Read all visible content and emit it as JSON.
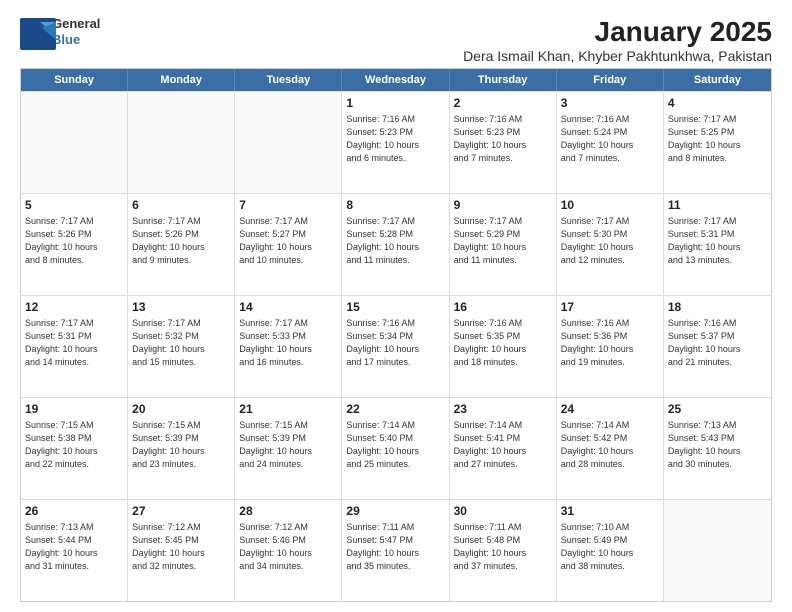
{
  "logo": {
    "line1": "General",
    "line2": "Blue"
  },
  "title": "January 2025",
  "subtitle": "Dera Ismail Khan, Khyber Pakhtunkhwa, Pakistan",
  "headers": [
    "Sunday",
    "Monday",
    "Tuesday",
    "Wednesday",
    "Thursday",
    "Friday",
    "Saturday"
  ],
  "weeks": [
    [
      {
        "day": "",
        "info": ""
      },
      {
        "day": "",
        "info": ""
      },
      {
        "day": "",
        "info": ""
      },
      {
        "day": "1",
        "info": "Sunrise: 7:16 AM\nSunset: 5:23 PM\nDaylight: 10 hours\nand 6 minutes."
      },
      {
        "day": "2",
        "info": "Sunrise: 7:16 AM\nSunset: 5:23 PM\nDaylight: 10 hours\nand 7 minutes."
      },
      {
        "day": "3",
        "info": "Sunrise: 7:16 AM\nSunset: 5:24 PM\nDaylight: 10 hours\nand 7 minutes."
      },
      {
        "day": "4",
        "info": "Sunrise: 7:17 AM\nSunset: 5:25 PM\nDaylight: 10 hours\nand 8 minutes."
      }
    ],
    [
      {
        "day": "5",
        "info": "Sunrise: 7:17 AM\nSunset: 5:26 PM\nDaylight: 10 hours\nand 8 minutes."
      },
      {
        "day": "6",
        "info": "Sunrise: 7:17 AM\nSunset: 5:26 PM\nDaylight: 10 hours\nand 9 minutes."
      },
      {
        "day": "7",
        "info": "Sunrise: 7:17 AM\nSunset: 5:27 PM\nDaylight: 10 hours\nand 10 minutes."
      },
      {
        "day": "8",
        "info": "Sunrise: 7:17 AM\nSunset: 5:28 PM\nDaylight: 10 hours\nand 11 minutes."
      },
      {
        "day": "9",
        "info": "Sunrise: 7:17 AM\nSunset: 5:29 PM\nDaylight: 10 hours\nand 11 minutes."
      },
      {
        "day": "10",
        "info": "Sunrise: 7:17 AM\nSunset: 5:30 PM\nDaylight: 10 hours\nand 12 minutes."
      },
      {
        "day": "11",
        "info": "Sunrise: 7:17 AM\nSunset: 5:31 PM\nDaylight: 10 hours\nand 13 minutes."
      }
    ],
    [
      {
        "day": "12",
        "info": "Sunrise: 7:17 AM\nSunset: 5:31 PM\nDaylight: 10 hours\nand 14 minutes."
      },
      {
        "day": "13",
        "info": "Sunrise: 7:17 AM\nSunset: 5:32 PM\nDaylight: 10 hours\nand 15 minutes."
      },
      {
        "day": "14",
        "info": "Sunrise: 7:17 AM\nSunset: 5:33 PM\nDaylight: 10 hours\nand 16 minutes."
      },
      {
        "day": "15",
        "info": "Sunrise: 7:16 AM\nSunset: 5:34 PM\nDaylight: 10 hours\nand 17 minutes."
      },
      {
        "day": "16",
        "info": "Sunrise: 7:16 AM\nSunset: 5:35 PM\nDaylight: 10 hours\nand 18 minutes."
      },
      {
        "day": "17",
        "info": "Sunrise: 7:16 AM\nSunset: 5:36 PM\nDaylight: 10 hours\nand 19 minutes."
      },
      {
        "day": "18",
        "info": "Sunrise: 7:16 AM\nSunset: 5:37 PM\nDaylight: 10 hours\nand 21 minutes."
      }
    ],
    [
      {
        "day": "19",
        "info": "Sunrise: 7:15 AM\nSunset: 5:38 PM\nDaylight: 10 hours\nand 22 minutes."
      },
      {
        "day": "20",
        "info": "Sunrise: 7:15 AM\nSunset: 5:39 PM\nDaylight: 10 hours\nand 23 minutes."
      },
      {
        "day": "21",
        "info": "Sunrise: 7:15 AM\nSunset: 5:39 PM\nDaylight: 10 hours\nand 24 minutes."
      },
      {
        "day": "22",
        "info": "Sunrise: 7:14 AM\nSunset: 5:40 PM\nDaylight: 10 hours\nand 25 minutes."
      },
      {
        "day": "23",
        "info": "Sunrise: 7:14 AM\nSunset: 5:41 PM\nDaylight: 10 hours\nand 27 minutes."
      },
      {
        "day": "24",
        "info": "Sunrise: 7:14 AM\nSunset: 5:42 PM\nDaylight: 10 hours\nand 28 minutes."
      },
      {
        "day": "25",
        "info": "Sunrise: 7:13 AM\nSunset: 5:43 PM\nDaylight: 10 hours\nand 30 minutes."
      }
    ],
    [
      {
        "day": "26",
        "info": "Sunrise: 7:13 AM\nSunset: 5:44 PM\nDaylight: 10 hours\nand 31 minutes."
      },
      {
        "day": "27",
        "info": "Sunrise: 7:12 AM\nSunset: 5:45 PM\nDaylight: 10 hours\nand 32 minutes."
      },
      {
        "day": "28",
        "info": "Sunrise: 7:12 AM\nSunset: 5:46 PM\nDaylight: 10 hours\nand 34 minutes."
      },
      {
        "day": "29",
        "info": "Sunrise: 7:11 AM\nSunset: 5:47 PM\nDaylight: 10 hours\nand 35 minutes."
      },
      {
        "day": "30",
        "info": "Sunrise: 7:11 AM\nSunset: 5:48 PM\nDaylight: 10 hours\nand 37 minutes."
      },
      {
        "day": "31",
        "info": "Sunrise: 7:10 AM\nSunset: 5:49 PM\nDaylight: 10 hours\nand 38 minutes."
      },
      {
        "day": "",
        "info": ""
      }
    ]
  ]
}
